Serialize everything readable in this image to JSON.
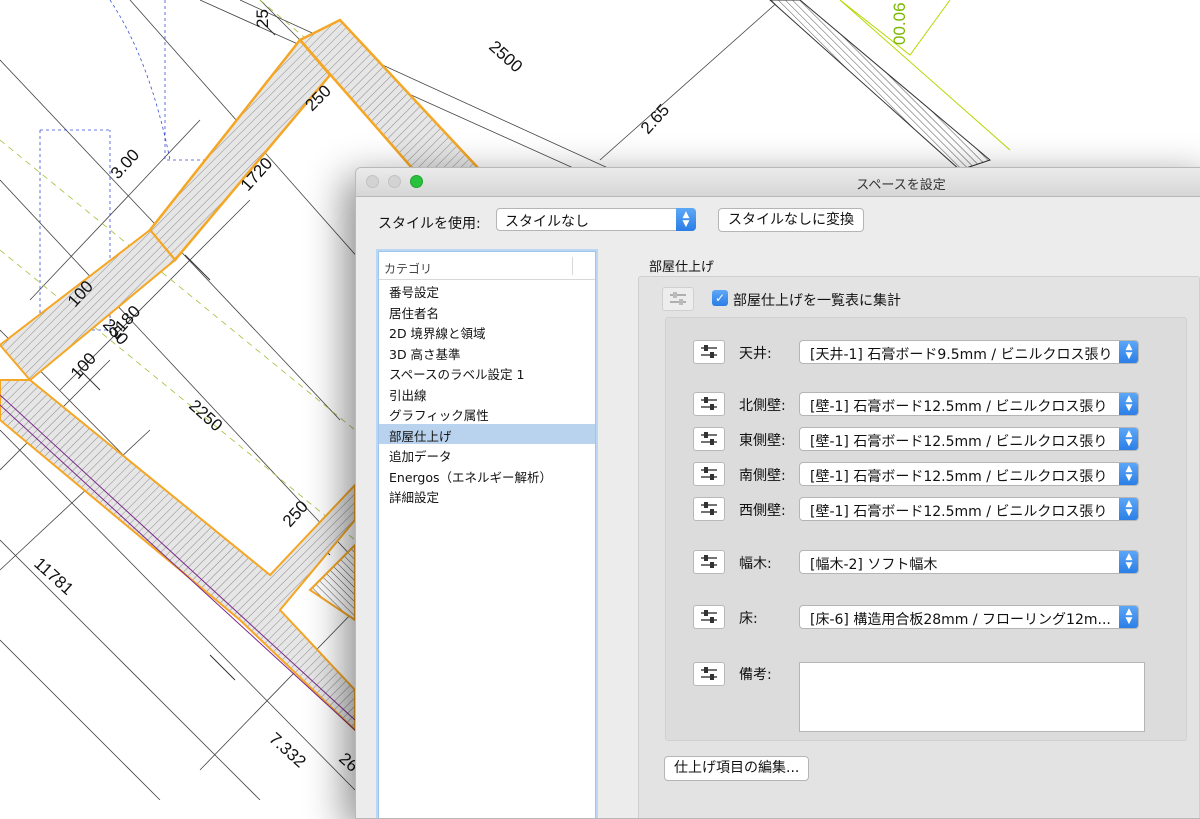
{
  "drawing": {
    "dimensions": [
      "25",
      "2500",
      "00.06",
      "250",
      "3.00",
      "2.65",
      "1720",
      "100",
      "2180",
      "250",
      "100",
      "2250",
      "250",
      "11781",
      "7.332",
      "26"
    ]
  },
  "window": {
    "title": "スペースを設定"
  },
  "style_row": {
    "label": "スタイルを使用:",
    "selected": "スタイルなし",
    "convert_button": "スタイルなしに変換"
  },
  "category": {
    "header": "カテゴリ",
    "items": [
      "番号設定",
      "居住者名",
      "2D 境界線と領域",
      "3D 高さ基準",
      "スペースのラベル設定 1",
      "引出線",
      "グラフィック属性",
      "部屋仕上げ",
      "追加データ",
      "Energos（エネルギー解析）",
      "詳細設定"
    ],
    "selected_index": 7
  },
  "finish": {
    "section_title": "部屋仕上げ",
    "checkbox_label": "部屋仕上げを一覧表に集計",
    "checkbox_checked": true,
    "rows": [
      {
        "label": "天井:",
        "value": "[天井-1] 石膏ボード9.5mm / ビニルクロス張り"
      },
      {
        "label": "北側壁:",
        "value": "[壁-1] 石膏ボード12.5mm / ビニルクロス張り"
      },
      {
        "label": "東側壁:",
        "value": "[壁-1] 石膏ボード12.5mm / ビニルクロス張り"
      },
      {
        "label": "南側壁:",
        "value": "[壁-1] 石膏ボード12.5mm / ビニルクロス張り"
      },
      {
        "label": "西側壁:",
        "value": "[壁-1] 石膏ボード12.5mm / ビニルクロス張り"
      },
      {
        "label": "幅木:",
        "value": "[幅木-2] ソフト幅木"
      },
      {
        "label": "床:",
        "value": "[床-6] 構造用合板28mm / フローリング12m..."
      }
    ],
    "remarks_label": "備考:",
    "remarks_value": "",
    "edit_button": "仕上げ項目の編集..."
  },
  "colors": {
    "accent": "#2a7de6",
    "wall_outline": "#f5a623",
    "dimension_green": "#7ab800"
  }
}
